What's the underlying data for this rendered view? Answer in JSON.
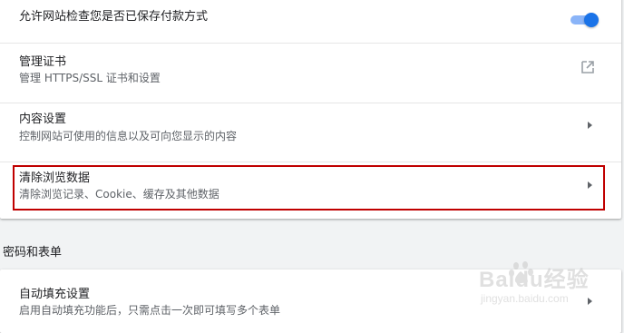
{
  "settings": {
    "payment_check": {
      "label": "允许网站检查您是否已保存付款方式",
      "enabled": true
    },
    "manage_certs": {
      "title": "管理证书",
      "subtitle": "管理 HTTPS/SSL 证书和设置",
      "icon": "open-in-new-icon"
    },
    "content_settings": {
      "title": "内容设置",
      "subtitle": "控制网站可使用的信息以及可向您显示的内容",
      "icon": "chevron-right-icon"
    },
    "clear_data": {
      "title": "清除浏览数据",
      "subtitle": "清除浏览记录、Cookie、缓存及其他数据",
      "icon": "chevron-right-icon"
    }
  },
  "passwords_section": {
    "header": "密码和表单",
    "autofill": {
      "title": "自动填充设置",
      "subtitle": "启用自动填充功能后，只需点击一次即可填写多个表单",
      "icon": "chevron-right-icon"
    }
  },
  "watermark": {
    "brand": "Baidu经验",
    "url": "jingyan.baidu.com"
  },
  "colors": {
    "toggle_on": "#1a73e8",
    "highlight_border": "#c00000"
  }
}
